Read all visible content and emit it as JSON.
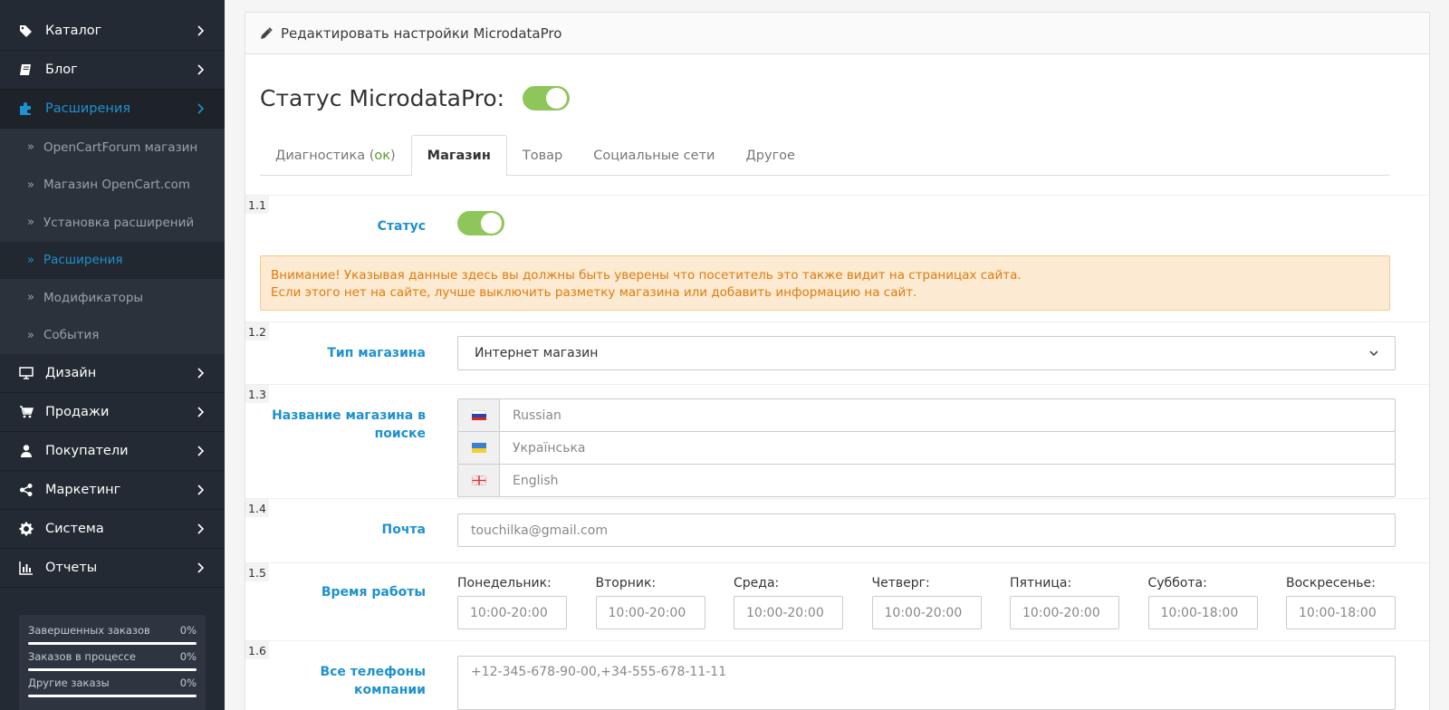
{
  "sidebar": {
    "items_top": [
      {
        "label": "Каталог",
        "icon": "tags-icon"
      },
      {
        "label": "Блог",
        "icon": "book-icon"
      },
      {
        "label": "Расширения",
        "icon": "puzzle-icon",
        "active": true
      }
    ],
    "sub_items": [
      {
        "label": "OpenCartForum магазин"
      },
      {
        "label": "Магазин OpenCart.com"
      },
      {
        "label": "Установка расширений"
      },
      {
        "label": "Расширения",
        "active": true
      },
      {
        "label": "Модификаторы"
      },
      {
        "label": "События"
      }
    ],
    "items_bottom": [
      {
        "label": "Дизайн",
        "icon": "desktop-icon"
      },
      {
        "label": "Продажи",
        "icon": "cart-icon"
      },
      {
        "label": "Покупатели",
        "icon": "user-icon"
      },
      {
        "label": "Маркетинг",
        "icon": "share-icon"
      },
      {
        "label": "Система",
        "icon": "gear-icon"
      },
      {
        "label": "Отчеты",
        "icon": "bar-chart-icon"
      }
    ],
    "stats": [
      {
        "label": "Завершенных заказов",
        "value": "0%"
      },
      {
        "label": "Заказов в процессе",
        "value": "0%"
      },
      {
        "label": "Другие заказы",
        "value": "0%"
      }
    ]
  },
  "panel": {
    "title": "Редактировать настройки MicrodataPro",
    "status_label": "Статус MicrodataPro:",
    "tabs": [
      {
        "label": "Диагностика (",
        "ok": "ок",
        "close": ")"
      },
      {
        "label": "Магазин"
      },
      {
        "label": "Товар"
      },
      {
        "label": "Социальные сети"
      },
      {
        "label": "Другое"
      }
    ]
  },
  "form": {
    "r1": {
      "num": "1.1",
      "label": "Статус"
    },
    "alert": {
      "line1": "Внимание! Указывая данные здесь вы должны быть уверены что посетитель это также видит на страницах сайта.",
      "line2": "Если этого нет на сайте, лучше выключить разметку магазина или добавить информацию на сайт."
    },
    "r2": {
      "num": "1.2",
      "label": "Тип магазина",
      "value": "Интернет магазин"
    },
    "r3": {
      "num": "1.3",
      "label": "Название магазина в поиске",
      "langs": [
        "Russian",
        "Українська",
        "English"
      ]
    },
    "r4": {
      "num": "1.4",
      "label": "Почта",
      "placeholder": "touchilka@gmail.com"
    },
    "r5": {
      "num": "1.5",
      "label": "Время работы",
      "days": [
        {
          "label": "Понедельник:",
          "value": "10:00-20:00"
        },
        {
          "label": "Вторник:",
          "value": "10:00-20:00"
        },
        {
          "label": "Среда:",
          "value": "10:00-20:00"
        },
        {
          "label": "Четверг:",
          "value": "10:00-20:00"
        },
        {
          "label": "Пятница:",
          "value": "10:00-20:00"
        },
        {
          "label": "Суббота:",
          "value": "10:00-18:00"
        },
        {
          "label": "Воскресенье:",
          "value": "10:00-18:00"
        }
      ]
    },
    "r6": {
      "num": "1.6",
      "label": "Все телефоны компании",
      "placeholder": "+12-345-678-90-00,+34-555-678-11-11"
    }
  },
  "colors": {
    "accent": "#1e91cf",
    "toggle_on": "#8fc65b",
    "sidebar_bg": "#242a33",
    "alert_text": "#e07a0e"
  }
}
